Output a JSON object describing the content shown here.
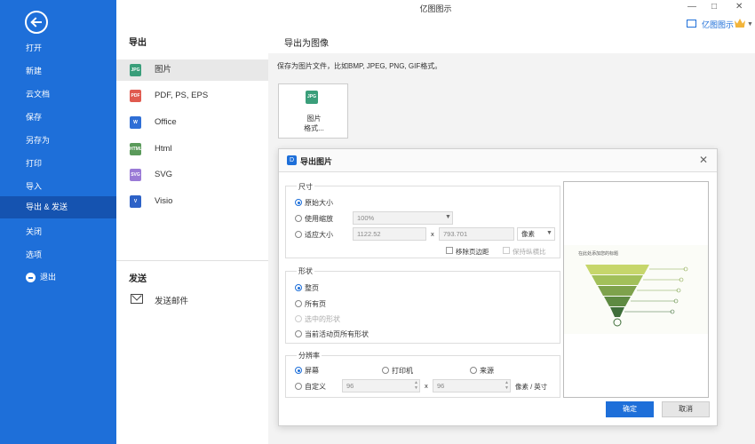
{
  "app": {
    "title": "亿图图示",
    "brand": "亿图图示"
  },
  "sidebar": {
    "items": [
      {
        "label": "打开"
      },
      {
        "label": "新建"
      },
      {
        "label": "云文档"
      },
      {
        "label": "保存"
      },
      {
        "label": "另存为"
      },
      {
        "label": "打印"
      },
      {
        "label": "导入"
      },
      {
        "label": "导出 & 发送"
      },
      {
        "label": "关闭"
      },
      {
        "label": "选项"
      },
      {
        "label": "退出"
      }
    ]
  },
  "export": {
    "heading": "导出",
    "formats": [
      {
        "label": "图片",
        "icon": "jpg-file-icon",
        "badge": "JPG",
        "color": "#3a9e7a"
      },
      {
        "label": "PDF, PS, EPS",
        "icon": "pdf-file-icon",
        "badge": "PDF",
        "color": "#e05a4f"
      },
      {
        "label": "Office",
        "icon": "word-file-icon",
        "badge": "W",
        "color": "#2f6fd6"
      },
      {
        "label": "Html",
        "icon": "html-file-icon",
        "badge": "HTML",
        "color": "#5a9a5a"
      },
      {
        "label": "SVG",
        "icon": "svg-file-icon",
        "badge": "SVG",
        "color": "#9a7ad6"
      },
      {
        "label": "Visio",
        "icon": "visio-file-icon",
        "badge": "V",
        "color": "#2d62c7"
      }
    ],
    "send_heading": "发送",
    "send_mail": "发送邮件"
  },
  "main": {
    "header": "导出为图像",
    "description": "保存为图片文件，比如BMP, JPEG, PNG, GIF格式。",
    "card_label_line1": "图片",
    "card_label_line2": "格式..."
  },
  "dialog": {
    "title": "导出图片",
    "size": {
      "label": "尺寸",
      "original": "原始大小",
      "scale": "使用缩放",
      "scale_value": "100%",
      "fit": "适应大小",
      "width": "1122.52",
      "x": "x",
      "height": "793.701",
      "unit": "像素",
      "remove_margin": "移除页边距",
      "keep_ratio": "保持纵横比"
    },
    "shape": {
      "label": "形状",
      "whole_page": "整页",
      "all_pages": "所有页",
      "selected": "选中的形状",
      "current_page_all": "当前活动页所有形状"
    },
    "resolution": {
      "label": "分辨率",
      "screen": "屏幕",
      "printer": "打印机",
      "source": "来源",
      "custom": "自定义",
      "dpi_x": "96",
      "x": "x",
      "dpi_y": "96",
      "unit": "像素 / 英寸"
    },
    "preview": {
      "title": "在此处添加您的标题"
    },
    "ok": "确定",
    "cancel": "取消"
  },
  "colors": {
    "accent": "#1e6fd9",
    "sidebar_active": "#1553b0"
  }
}
